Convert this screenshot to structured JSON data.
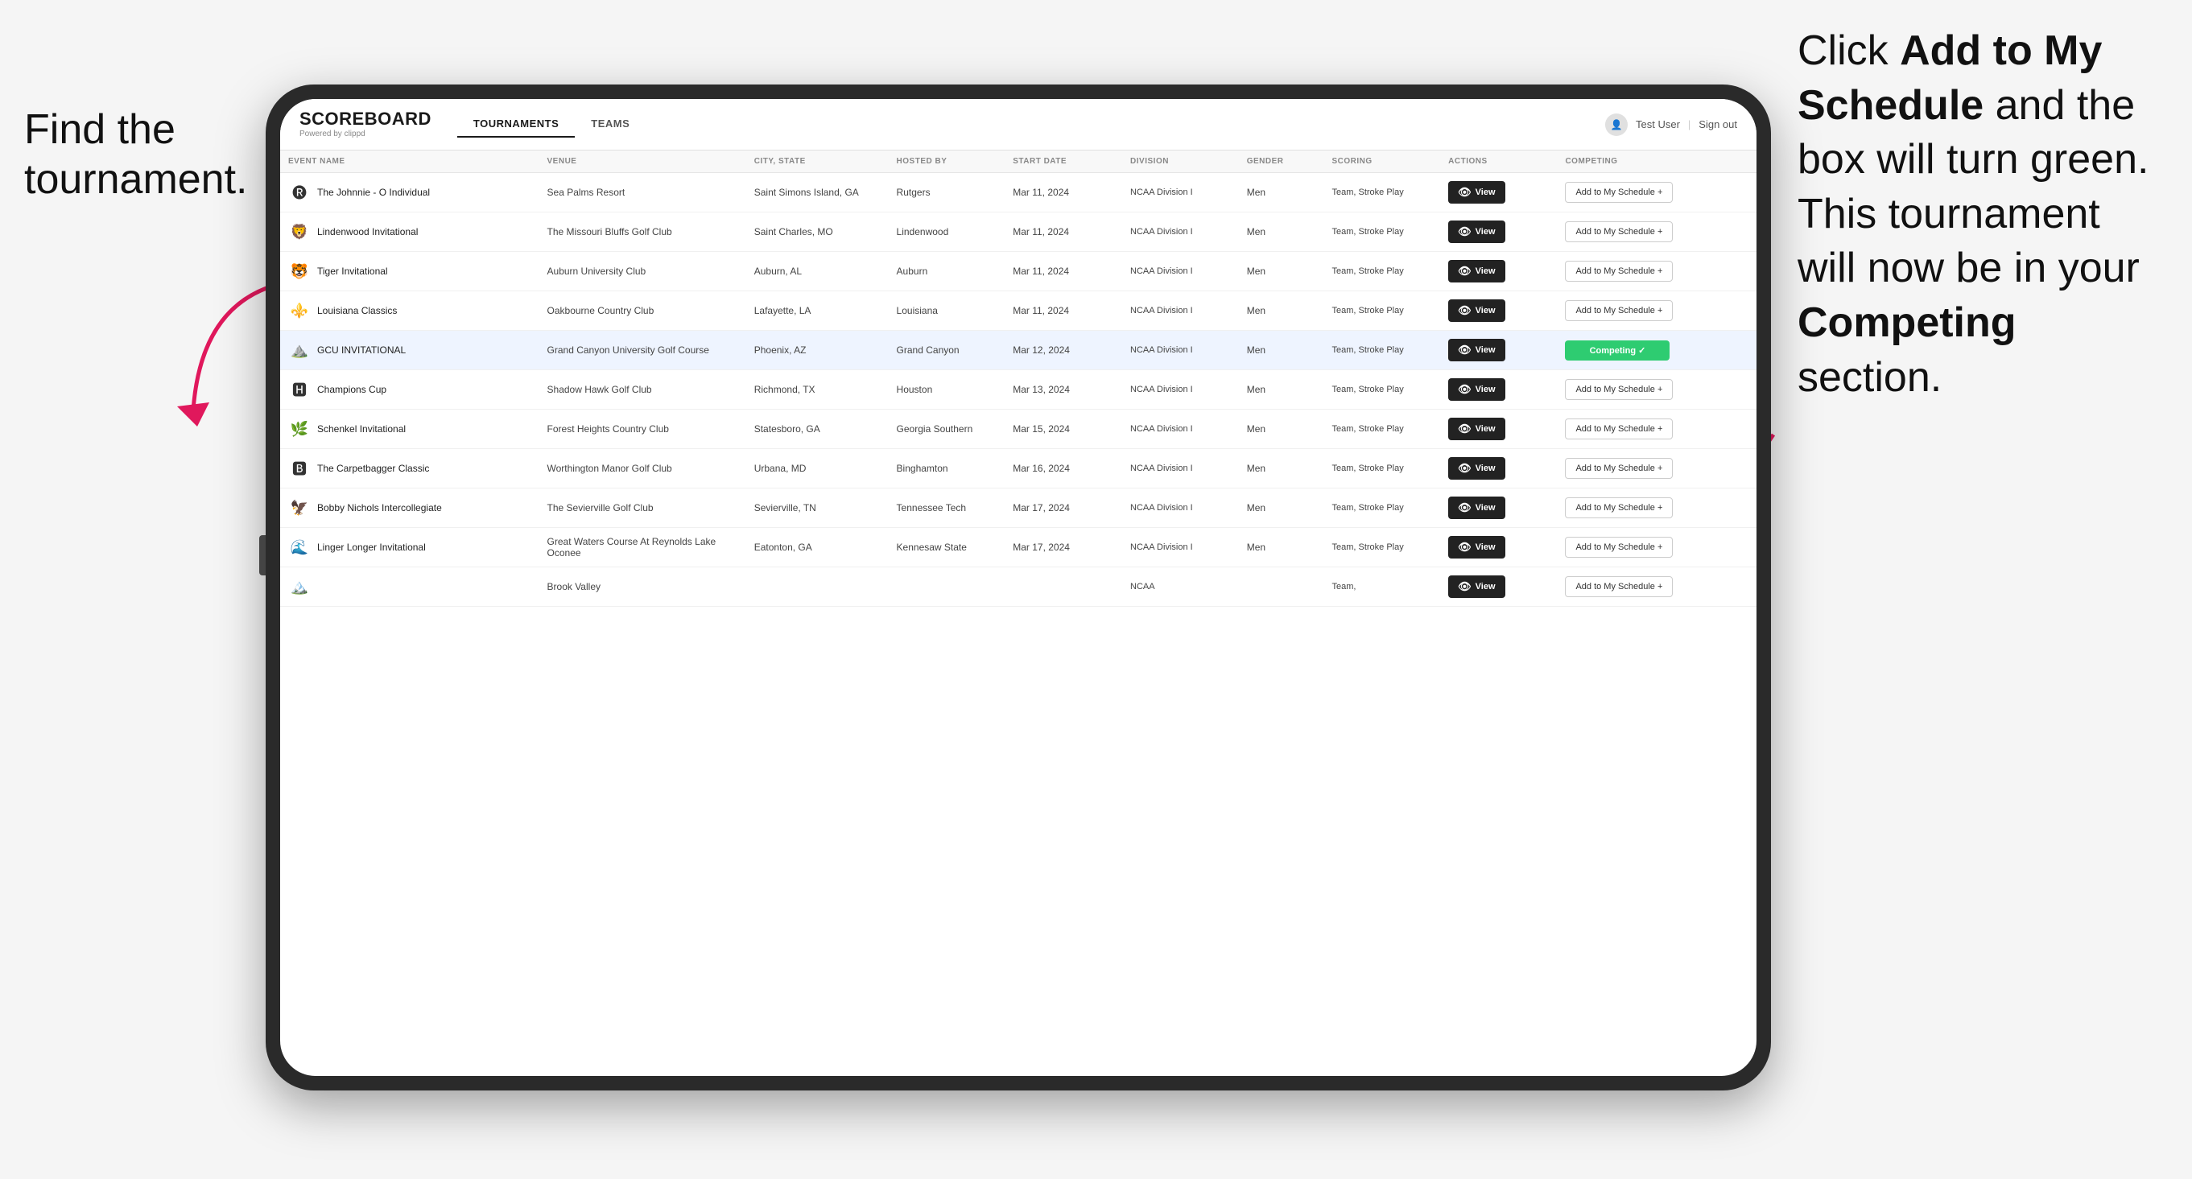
{
  "annotations": {
    "left": "Find the tournament.",
    "right_line1": "Click ",
    "right_bold1": "Add to My Schedule",
    "right_line2": " and the box will turn green. This tournament will now be in your ",
    "right_bold2": "Competing",
    "right_line3": " section."
  },
  "header": {
    "logo": "SCOREBOARD",
    "powered_by": "Powered by clippd",
    "nav_tabs": [
      "TOURNAMENTS",
      "TEAMS"
    ],
    "active_tab": "TOURNAMENTS",
    "user": "Test User",
    "sign_out": "Sign out"
  },
  "table": {
    "columns": [
      "EVENT NAME",
      "VENUE",
      "CITY, STATE",
      "HOSTED BY",
      "START DATE",
      "DIVISION",
      "GENDER",
      "SCORING",
      "ACTIONS",
      "COMPETING"
    ],
    "rows": [
      {
        "logo": "🅡",
        "event_name": "The Johnnie - O Individual",
        "venue": "Sea Palms Resort",
        "city_state": "Saint Simons Island, GA",
        "hosted_by": "Rutgers",
        "start_date": "Mar 11, 2024",
        "division": "NCAA Division I",
        "gender": "Men",
        "scoring": "Team, Stroke Play",
        "competing_status": "add",
        "highlighted": false
      },
      {
        "logo": "🦁",
        "event_name": "Lindenwood Invitational",
        "venue": "The Missouri Bluffs Golf Club",
        "city_state": "Saint Charles, MO",
        "hosted_by": "Lindenwood",
        "start_date": "Mar 11, 2024",
        "division": "NCAA Division I",
        "gender": "Men",
        "scoring": "Team, Stroke Play",
        "competing_status": "add",
        "highlighted": false
      },
      {
        "logo": "🐯",
        "event_name": "Tiger Invitational",
        "venue": "Auburn University Club",
        "city_state": "Auburn, AL",
        "hosted_by": "Auburn",
        "start_date": "Mar 11, 2024",
        "division": "NCAA Division I",
        "gender": "Men",
        "scoring": "Team, Stroke Play",
        "competing_status": "add",
        "highlighted": false
      },
      {
        "logo": "⚜️",
        "event_name": "Louisiana Classics",
        "venue": "Oakbourne Country Club",
        "city_state": "Lafayette, LA",
        "hosted_by": "Louisiana",
        "start_date": "Mar 11, 2024",
        "division": "NCAA Division I",
        "gender": "Men",
        "scoring": "Team, Stroke Play",
        "competing_status": "add",
        "highlighted": false
      },
      {
        "logo": "⛰️",
        "event_name": "GCU INVITATIONAL",
        "venue": "Grand Canyon University Golf Course",
        "city_state": "Phoenix, AZ",
        "hosted_by": "Grand Canyon",
        "start_date": "Mar 12, 2024",
        "division": "NCAA Division I",
        "gender": "Men",
        "scoring": "Team, Stroke Play",
        "competing_status": "competing",
        "highlighted": true
      },
      {
        "logo": "🅷",
        "event_name": "Champions Cup",
        "venue": "Shadow Hawk Golf Club",
        "city_state": "Richmond, TX",
        "hosted_by": "Houston",
        "start_date": "Mar 13, 2024",
        "division": "NCAA Division I",
        "gender": "Men",
        "scoring": "Team, Stroke Play",
        "competing_status": "add",
        "highlighted": false
      },
      {
        "logo": "🌿",
        "event_name": "Schenkel Invitational",
        "venue": "Forest Heights Country Club",
        "city_state": "Statesboro, GA",
        "hosted_by": "Georgia Southern",
        "start_date": "Mar 15, 2024",
        "division": "NCAA Division I",
        "gender": "Men",
        "scoring": "Team, Stroke Play",
        "competing_status": "add",
        "highlighted": false
      },
      {
        "logo": "🅱",
        "event_name": "The Carpetbagger Classic",
        "venue": "Worthington Manor Golf Club",
        "city_state": "Urbana, MD",
        "hosted_by": "Binghamton",
        "start_date": "Mar 16, 2024",
        "division": "NCAA Division I",
        "gender": "Men",
        "scoring": "Team, Stroke Play",
        "competing_status": "add",
        "highlighted": false
      },
      {
        "logo": "🦅",
        "event_name": "Bobby Nichols Intercollegiate",
        "venue": "The Sevierville Golf Club",
        "city_state": "Sevierville, TN",
        "hosted_by": "Tennessee Tech",
        "start_date": "Mar 17, 2024",
        "division": "NCAA Division I",
        "gender": "Men",
        "scoring": "Team, Stroke Play",
        "competing_status": "add",
        "highlighted": false
      },
      {
        "logo": "🌊",
        "event_name": "Linger Longer Invitational",
        "venue": "Great Waters Course At Reynolds Lake Oconee",
        "city_state": "Eatonton, GA",
        "hosted_by": "Kennesaw State",
        "start_date": "Mar 17, 2024",
        "division": "NCAA Division I",
        "gender": "Men",
        "scoring": "Team, Stroke Play",
        "competing_status": "add",
        "highlighted": false
      },
      {
        "logo": "🏔️",
        "event_name": "",
        "venue": "Brook Valley",
        "city_state": "",
        "hosted_by": "",
        "start_date": "",
        "division": "NCAA",
        "gender": "",
        "scoring": "Team,",
        "competing_status": "add",
        "highlighted": false
      }
    ],
    "view_label": "View",
    "add_label": "Add to My Schedule +",
    "competing_label": "Competing ✓"
  }
}
